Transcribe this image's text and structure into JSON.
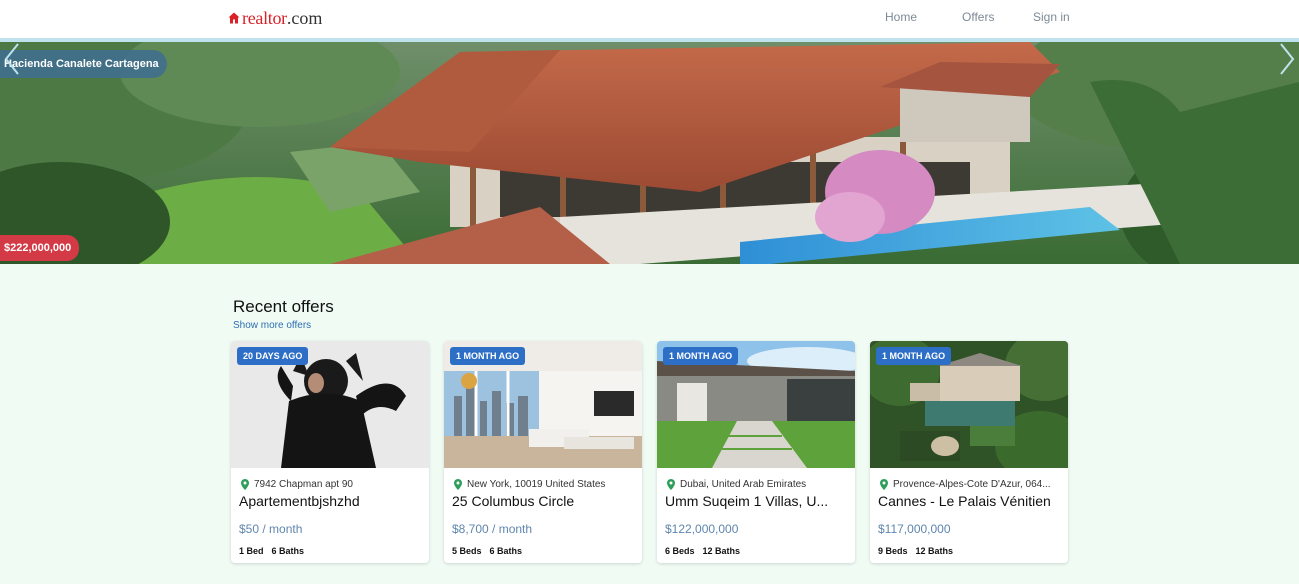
{
  "header": {
    "logo": "realtor",
    "logo_suffix": ".com",
    "nav": [
      "Home",
      "Offers",
      "Sign in"
    ]
  },
  "hero": {
    "title": "Hacienda Canalete Cartagena",
    "price": "$222,000,000"
  },
  "section": {
    "title": "Recent offers",
    "show_more": "Show more offers"
  },
  "cards": [
    {
      "badge": "20 DAYS AGO",
      "location": "7942 Chapman apt 90",
      "title": "Apartementbjshzhd",
      "price": "$50 / month",
      "beds": "1 Bed",
      "baths": "6 Baths"
    },
    {
      "badge": "1 MONTH AGO",
      "location": "New York, 10019 United States",
      "title": "25 Columbus Circle",
      "price": "$8,700 / month",
      "beds": "5 Beds",
      "baths": "6 Baths"
    },
    {
      "badge": "1 MONTH AGO",
      "location": "Dubai, United Arab Emirates",
      "title": "Umm Suqeim 1 Villas, U...",
      "price": "$122,000,000",
      "beds": "6 Beds",
      "baths": "12 Baths"
    },
    {
      "badge": "1 MONTH AGO",
      "location": "Provence-Alpes-Cote D'Azur, 064...",
      "title": "Cannes - Le Palais Vénitien",
      "price": "$117,000,000",
      "beds": "9 Beds",
      "baths": "12 Baths"
    }
  ],
  "colors": {
    "brand_red": "#d92228",
    "badge_blue": "#2d6fc7",
    "price_blue": "#5f86ad",
    "link_blue": "#2f6fb1",
    "page_bg": "#f0fbf4",
    "pin_green": "#2e9e5b"
  },
  "icons": [
    "house-logo-icon",
    "chevron-left-icon",
    "chevron-right-icon",
    "location-pin-icon"
  ]
}
